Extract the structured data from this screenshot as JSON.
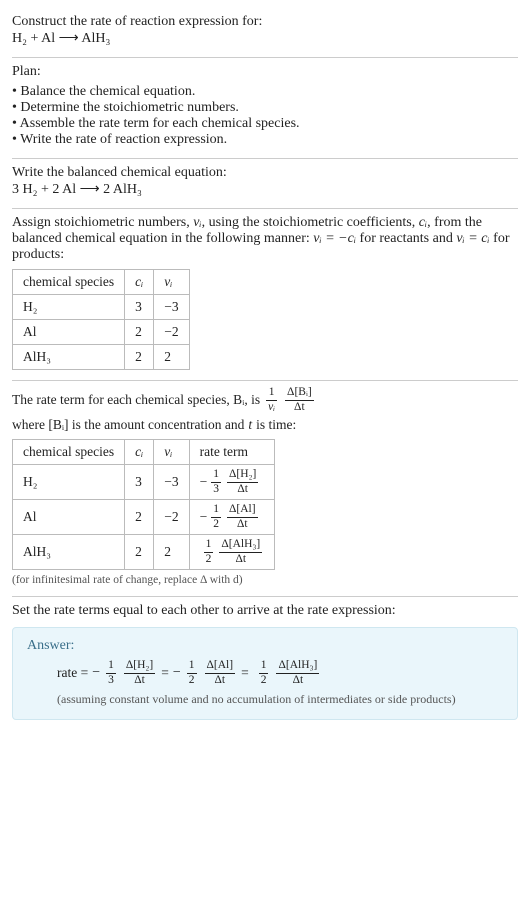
{
  "prompt": {
    "line1": "Construct the rate of reaction expression for:",
    "equation": "H₂ + Al ⟶ AlH₃"
  },
  "plan": {
    "heading": "Plan:",
    "items": [
      "Balance the chemical equation.",
      "Determine the stoichiometric numbers.",
      "Assemble the rate term for each chemical species.",
      "Write the rate of reaction expression."
    ]
  },
  "balanced": {
    "heading": "Write the balanced chemical equation:",
    "equation": "3 H₂ + 2 Al ⟶ 2 AlH₃"
  },
  "assign": {
    "text_a": "Assign stoichiometric numbers, ",
    "nu_i": "νᵢ",
    "text_b": ", using the stoichiometric coefficients, ",
    "c_i": "cᵢ",
    "text_c": ", from the balanced chemical equation in the following manner: ",
    "rel1": "νᵢ = −cᵢ",
    "text_d": " for reactants and ",
    "rel2": "νᵢ = cᵢ",
    "text_e": " for products:",
    "table": {
      "headers": [
        "chemical species",
        "cᵢ",
        "νᵢ"
      ],
      "rows": [
        {
          "sp": "H₂",
          "c": "3",
          "nu": "−3"
        },
        {
          "sp": "Al",
          "c": "2",
          "nu": "−2"
        },
        {
          "sp": "AlH₃",
          "c": "2",
          "nu": "2"
        }
      ]
    }
  },
  "rateterm": {
    "text_a": "The rate term for each chemical species, Bᵢ, is ",
    "frac1_num": "1",
    "frac1_den": "νᵢ",
    "frac2_num": "Δ[Bᵢ]",
    "frac2_den": "Δt",
    "text_b": " where [Bᵢ] is the amount concentration and ",
    "t": "t",
    "text_c": " is time:",
    "table": {
      "headers": [
        "chemical species",
        "cᵢ",
        "νᵢ",
        "rate term"
      ],
      "rows": [
        {
          "sp": "H₂",
          "c": "3",
          "nu": "−3",
          "sign": "−",
          "coef_num": "1",
          "coef_den": "3",
          "d_num": "Δ[H₂]",
          "d_den": "Δt"
        },
        {
          "sp": "Al",
          "c": "2",
          "nu": "−2",
          "sign": "−",
          "coef_num": "1",
          "coef_den": "2",
          "d_num": "Δ[Al]",
          "d_den": "Δt"
        },
        {
          "sp": "AlH₃",
          "c": "2",
          "nu": "2",
          "sign": "",
          "coef_num": "1",
          "coef_den": "2",
          "d_num": "Δ[AlH₃]",
          "d_den": "Δt"
        }
      ]
    },
    "note": "(for infinitesimal rate of change, replace Δ with d)"
  },
  "final": {
    "heading": "Set the rate terms equal to each other to arrive at the rate expression:"
  },
  "answer": {
    "label": "Answer:",
    "lead": "rate = ",
    "terms": [
      {
        "sign": "−",
        "coef_num": "1",
        "coef_den": "3",
        "d_num": "Δ[H₂]",
        "d_den": "Δt",
        "after": " = "
      },
      {
        "sign": "−",
        "coef_num": "1",
        "coef_den": "2",
        "d_num": "Δ[Al]",
        "d_den": "Δt",
        "after": " = "
      },
      {
        "sign": "",
        "coef_num": "1",
        "coef_den": "2",
        "d_num": "Δ[AlH₃]",
        "d_den": "Δt",
        "after": ""
      }
    ],
    "note": "(assuming constant volume and no accumulation of intermediates or side products)"
  },
  "chart_data": {
    "type": "table",
    "tables": [
      {
        "title": "Stoichiometric numbers",
        "headers": [
          "chemical species",
          "c_i",
          "nu_i"
        ],
        "rows": [
          [
            "H2",
            3,
            -3
          ],
          [
            "Al",
            2,
            -2
          ],
          [
            "AlH3",
            2,
            2
          ]
        ]
      },
      {
        "title": "Rate terms",
        "headers": [
          "chemical species",
          "c_i",
          "nu_i",
          "rate term"
        ],
        "rows": [
          [
            "H2",
            3,
            -3,
            "-(1/3) Δ[H2]/Δt"
          ],
          [
            "Al",
            2,
            -2,
            "-(1/2) Δ[Al]/Δt"
          ],
          [
            "AlH3",
            2,
            2,
            "(1/2) Δ[AlH3]/Δt"
          ]
        ]
      }
    ],
    "rate_expression": "rate = -(1/3) Δ[H2]/Δt = -(1/2) Δ[Al]/Δt = (1/2) Δ[AlH3]/Δt"
  }
}
